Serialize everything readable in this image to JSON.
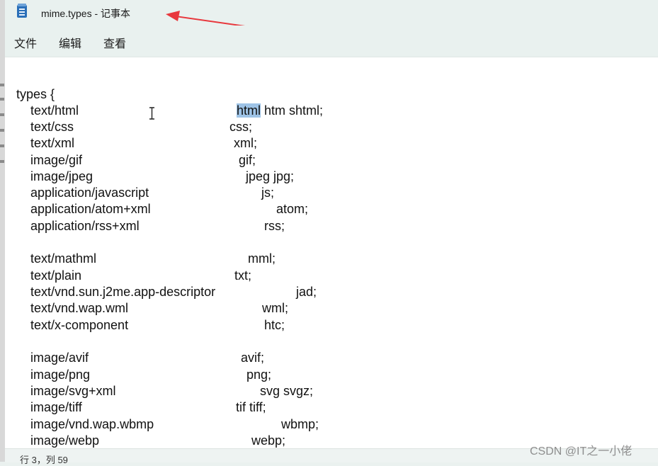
{
  "window": {
    "title": "mime.types - 记事本"
  },
  "menu": {
    "file": "文件",
    "edit": "编辑",
    "view": "查看"
  },
  "editor": {
    "header": "types {",
    "entries": [
      {
        "mime": "text/html",
        "ext_before": "",
        "ext_selected": "html",
        "ext_after": " htm shtml;"
      },
      {
        "mime": "text/css",
        "ext": "css;"
      },
      {
        "mime": "text/xml",
        "ext": "xml;"
      },
      {
        "mime": "image/gif",
        "ext": "gif;"
      },
      {
        "mime": "image/jpeg",
        "ext": "jpeg jpg;"
      },
      {
        "mime": "application/javascript",
        "ext": "js;"
      },
      {
        "mime": "application/atom+xml",
        "ext": "atom;"
      },
      {
        "mime": "application/rss+xml",
        "ext": "rss;"
      },
      {
        "mime": "text/mathml",
        "ext": "mml;"
      },
      {
        "mime": "text/plain",
        "ext": "txt;"
      },
      {
        "mime": "text/vnd.sun.j2me.app-descriptor",
        "ext": "jad;"
      },
      {
        "mime": "text/vnd.wap.wml",
        "ext": "wml;"
      },
      {
        "mime": "text/x-component",
        "ext": "htc;"
      },
      {
        "mime": "image/avif",
        "ext": "avif;"
      },
      {
        "mime": "image/png",
        "ext": "png;"
      },
      {
        "mime": "image/svg+xml",
        "ext": "svg svgz;"
      },
      {
        "mime": "image/tiff",
        "ext": "tif tiff;"
      },
      {
        "mime": "image/vnd.wap.wbmp",
        "ext": "wbmp;"
      },
      {
        "mime": "image/webp",
        "ext": "webp;"
      }
    ]
  },
  "status": {
    "position": "行 3，列 59"
  },
  "watermark": "CSDN @IT之一小佬",
  "colors": {
    "selection": "#9ec3e6",
    "arrow": "#e8383d",
    "icon": "#2a6fb8"
  }
}
